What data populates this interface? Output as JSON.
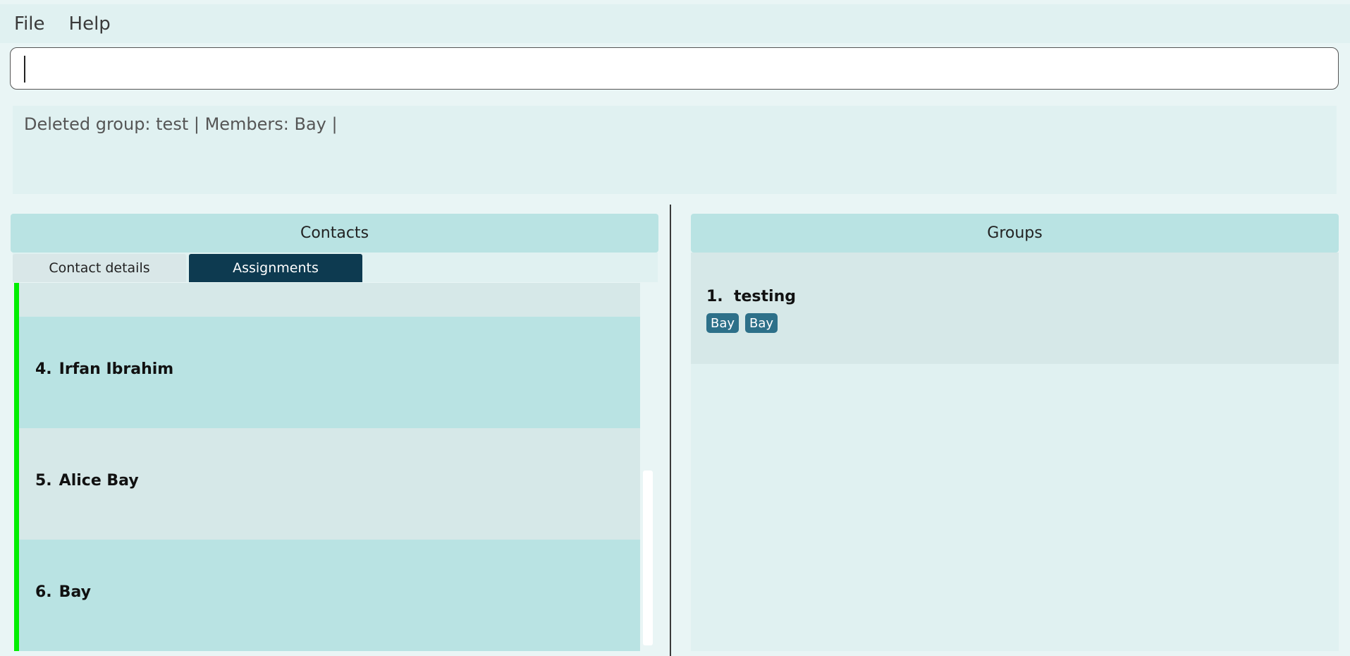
{
  "menu": {
    "items": [
      "File",
      "Help"
    ]
  },
  "command": {
    "value": "",
    "placeholder": ""
  },
  "result": {
    "text": "Deleted group: test | Members: Bay |"
  },
  "contacts": {
    "header": "Contacts",
    "tabs": [
      {
        "label": "Contact details",
        "active": false
      },
      {
        "label": "Assignments",
        "active": true
      }
    ],
    "items": [
      {
        "index": "4.",
        "name": "Irfan Ibrahim"
      },
      {
        "index": "5.",
        "name": "Alice Bay"
      },
      {
        "index": "6.",
        "name": "Bay"
      }
    ]
  },
  "groups": {
    "header": "Groups",
    "items": [
      {
        "title": "1.  testing",
        "members": [
          "Bay",
          "Bay"
        ]
      }
    ]
  },
  "colors": {
    "background": "#e9f5f5",
    "header_bg": "#b9e3e3",
    "active_tab_bg": "#0d3a50",
    "accent_bar": "#00ee00",
    "tag_bg": "#2d7089"
  }
}
